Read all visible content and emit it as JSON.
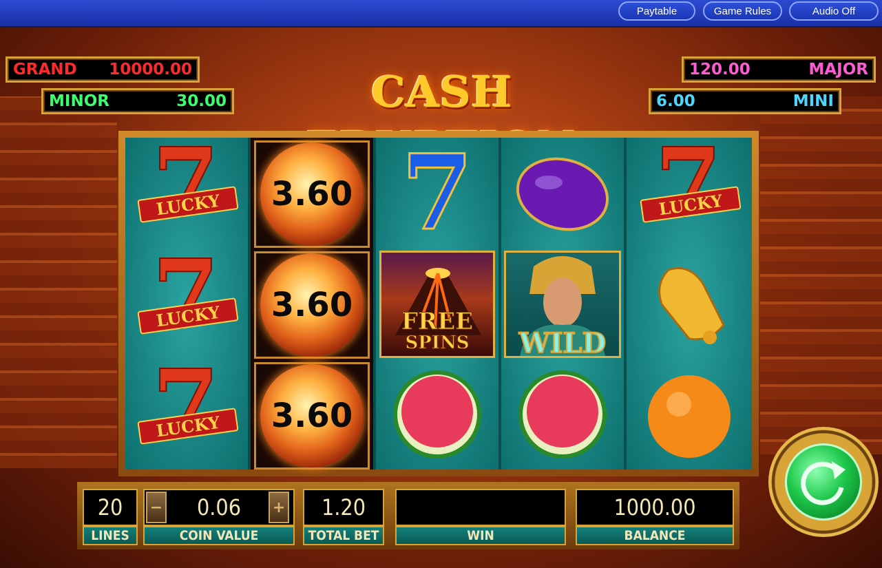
{
  "topbar": {
    "paytable": "Paytable",
    "game_rules": "Game Rules",
    "audio": "Audio Off"
  },
  "title": "CASH ERUPTION",
  "jackpots": {
    "grand": {
      "label": "GRAND",
      "value": "10000.00"
    },
    "minor": {
      "label": "MINOR",
      "value": "30.00"
    },
    "major": {
      "label": "MAJOR",
      "value": "120.00"
    },
    "mini": {
      "label": "MINI",
      "value": "6.00"
    }
  },
  "symbols": {
    "lucky": "LUCKY",
    "fireball_value": "3.60",
    "free": "FREE",
    "spins": "SPINS",
    "wild": "WILD"
  },
  "reels": [
    [
      "lucky-seven",
      "lucky-seven",
      "lucky-seven"
    ],
    [
      "fireball",
      "fireball",
      "fireball"
    ],
    [
      "blue-seven",
      "free-spins",
      "watermelon"
    ],
    [
      "plum",
      "wild",
      "watermelon"
    ],
    [
      "lucky-seven",
      "bell",
      "orange"
    ]
  ],
  "panel": {
    "lines_value": "20",
    "lines_label": "LINES",
    "coin_value": "0.06",
    "coin_label": "COIN VALUE",
    "total_bet_value": "1.20",
    "total_bet_label": "TOTAL BET",
    "win_value": "",
    "win_label": "WIN",
    "balance_value": "1000.00",
    "balance_label": "BALANCE"
  },
  "colors": {
    "topbar": "#1f36b8",
    "jackpot_frame": "#d8a436",
    "reel_bg": "#0e7a78",
    "spin_green": "#1ec84a"
  }
}
